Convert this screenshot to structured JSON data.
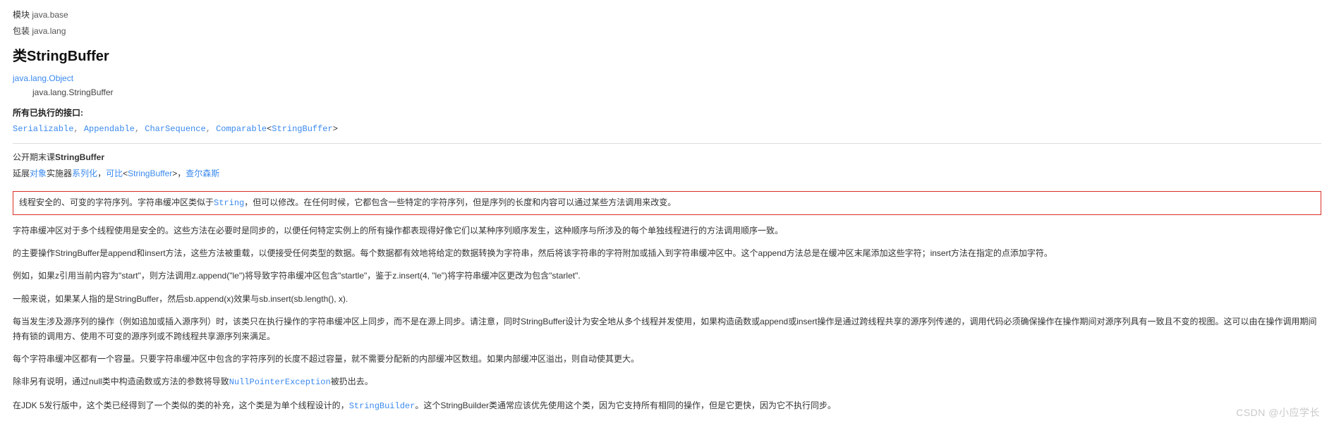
{
  "meta": {
    "module_label": "模块",
    "module_value": " java.base",
    "package_label": "包装",
    "package_value": " java.lang"
  },
  "title": {
    "prefix": "类",
    "name": "StringBuffer"
  },
  "inheritance": {
    "root": "java.lang.Object",
    "leaf": "java.lang.StringBuffer"
  },
  "interfaces": {
    "label": "所有已执行的接口:",
    "serializable": "Serializable",
    "appendable": "Appendable",
    "charsequence": "CharSequence",
    "comparable_pre": "Comparable",
    "comparable_arg": "StringBuffer"
  },
  "declaration": {
    "line1_pre": "公开期末课",
    "line1_strong": "StringBuffer",
    "extends_label": "延展",
    "extends_obj": "对象",
    "impl_label": "实施器",
    "impl1": "系列化",
    "impl2": "可比",
    "impl2_arg": "StringBuffer",
    "impl3": "查尔森斯"
  },
  "boxed": {
    "t1": "线程安全的、可变的字符序列。字符串缓冲区类似于",
    "t_string": "String",
    "t2": "，但可以修改。在任何时候，它都包含一些特定的字符序列，但是序列的长度和内容可以通过某些方法调用来改变。"
  },
  "paras": {
    "p1": "字符串缓冲区对于多个线程使用是安全的。这些方法在必要时是同步的，以便任何特定实例上的所有操作都表现得好像它们以某种序列顺序发生，这种顺序与所涉及的每个单独线程进行的方法调用顺序一致。",
    "p2_a": "的主要操作StringBuffer是append和insert方法，这些方法被重载，以便接受任何类型的数据。每个数据都有效地将给定的数据转换为字符串，然后将该字符串的字符附加或插入到字符串缓冲区中。这个append方法总是在缓冲区末尾添加这些字符；insert方法在指定的点添加字符。",
    "p3_a": "例如，如果z引用当前内容为\"start\"，则方法调用z.append(\"le\")将导致字符串缓冲区包含\"startle\"，鉴于z.insert(4, \"le\")将字符串缓冲区更改为包含\"starlet\".",
    "p4_a": "一般来说，如果某人指的是StringBuffer，然后sb.append(x)效果与sb.insert(sb.length(), x).",
    "p5": "每当发生涉及源序列的操作（例如追加或插入源序列）时，该类只在执行操作的字符串缓冲区上同步，而不是在源上同步。请注意，同时StringBuffer设计为安全地从多个线程并发使用，如果构造函数或append或insert操作是通过跨线程共享的源序列传递的，调用代码必须确保操作在操作期间对源序列具有一致且不变的视图。这可以由在操作调用期间持有锁的调用方、使用不可变的源序列或不跨线程共享源序列来满足。",
    "p6": "每个字符串缓冲区都有一个容量。只要字符串缓冲区中包含的字符序列的长度不超过容量，就不需要分配新的内部缓冲区数组。如果内部缓冲区溢出，则自动使其更大。",
    "p7_a": "除非另有说明，通过null类中构造函数或方法的参数将导致",
    "p7_link": "NullPointerException",
    "p7_b": "被扔出去。",
    "p8_a": "在JDK 5发行版中，这个类已经得到了一个类似的类的补充，这个类是为单个线程设计的，",
    "p8_link": "StringBuilder",
    "p8_b": "。这个StringBuilder类通常应该优先使用这个类，因为它支持所有相同的操作，但是它更快，因为它不执行同步。"
  },
  "watermark": "CSDN @小应学长"
}
